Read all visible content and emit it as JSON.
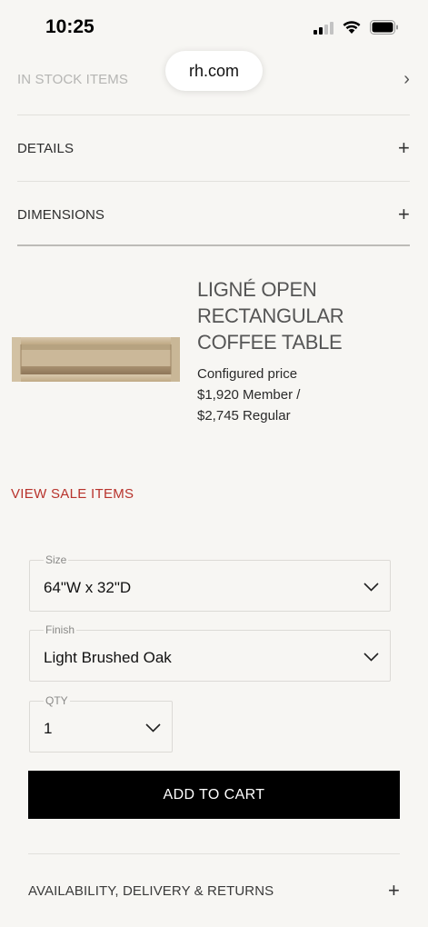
{
  "status_bar": {
    "time": "10:25"
  },
  "browser": {
    "url": "rh.com"
  },
  "accordions": [
    {
      "label": "IN STOCK ITEMS"
    },
    {
      "label": "DETAILS"
    },
    {
      "label": "DIMENSIONS"
    }
  ],
  "product": {
    "name": "LIGNÉ OPEN RECTANGULAR COFFEE TABLE",
    "price_label": "Configured price",
    "member_price": "$1,920 Member /",
    "regular_price": "$2,745 Regular"
  },
  "sale_link": "VIEW SALE ITEMS",
  "options": {
    "size": {
      "label": "Size",
      "value": "64\"W x 32\"D"
    },
    "finish": {
      "label": "Finish",
      "value": "Light Brushed Oak"
    },
    "qty": {
      "label": "QTY",
      "value": "1"
    }
  },
  "add_to_cart": "ADD TO CART",
  "availability": "AVAILABILITY, DELIVERY & RETURNS",
  "icons": {
    "chevron_right": "›",
    "plus": "+"
  },
  "colors": {
    "background": "#f7f6f3",
    "sale_red": "#b8332c",
    "button_black": "#000000"
  }
}
